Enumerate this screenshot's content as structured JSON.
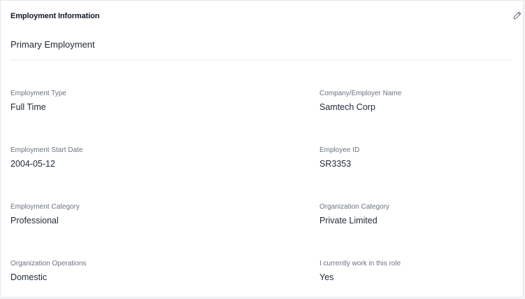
{
  "card": {
    "title": "Employment Information",
    "edit_icon": "pencil-icon"
  },
  "section": {
    "title": "Primary Employment"
  },
  "fields": {
    "employment_type": {
      "label": "Employment Type",
      "value": "Full Time"
    },
    "company_name": {
      "label": "Company/Employer Name",
      "value": "Samtech Corp"
    },
    "start_date": {
      "label": "Employment Start Date",
      "value": "2004-05-12"
    },
    "employee_id": {
      "label": "Employee ID",
      "value": "SR3353"
    },
    "employment_category": {
      "label": "Employment Category",
      "value": "Professional"
    },
    "organization_category": {
      "label": "Organization Category",
      "value": "Private Limited"
    },
    "organization_operations": {
      "label": "Organization Operations",
      "value": "Domestic"
    },
    "currently_work": {
      "label": "I currently work in this role",
      "value": "Yes"
    }
  }
}
